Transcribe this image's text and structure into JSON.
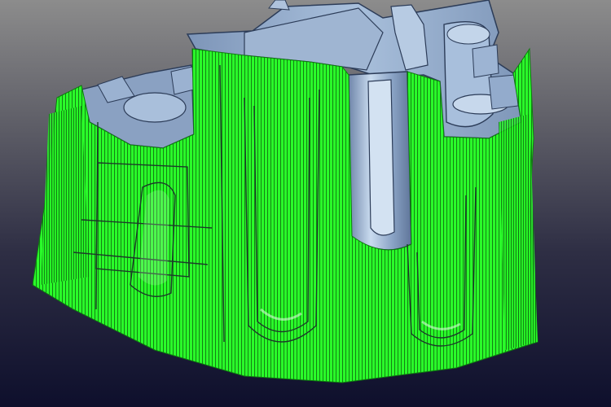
{
  "viewport": {
    "background_top": "#8c8c8c",
    "background_bottom": "#0e0f2c"
  },
  "model": {
    "surface_color": "#8fa8c8",
    "surface_highlight": "#c4d6ea",
    "edge_color": "#2c3c58"
  },
  "toolpath": {
    "color": "#22ff22",
    "dark_stroke": "#0b5a0b"
  }
}
